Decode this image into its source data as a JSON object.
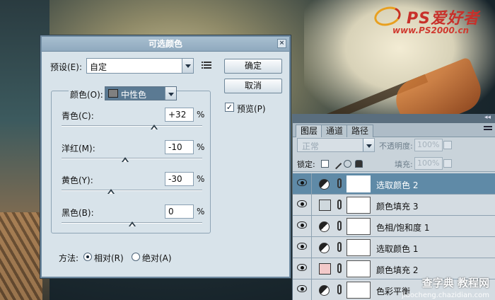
{
  "logo": {
    "brand": "PS爱好者",
    "url": "www.PS2000.cn"
  },
  "dialog": {
    "title": "可选颜色",
    "close": "×",
    "preset_label": "预设(E):",
    "preset_value": "自定",
    "ok": "确定",
    "cancel": "取消",
    "preview_label": "预览(P)",
    "preview_checked": true,
    "colors_label": "颜色(O):",
    "colors_value": "中性色",
    "sliders": [
      {
        "label": "青色(C):",
        "value": "+32",
        "unit": "%",
        "level": 32
      },
      {
        "label": "洋红(M):",
        "value": "-10",
        "unit": "%",
        "level": -10
      },
      {
        "label": "黄色(Y):",
        "value": "-30",
        "unit": "%",
        "level": -30
      },
      {
        "label": "黑色(B):",
        "value": "0",
        "unit": "%",
        "level": 0
      }
    ],
    "method_label": "方法:",
    "method_options": [
      "相对(R)",
      "绝对(A)"
    ],
    "method_selected": "相对(R)"
  },
  "layers_panel": {
    "tabs": [
      "图层",
      "通道",
      "路径"
    ],
    "active_tab": "图层",
    "blend_mode": "正常",
    "opacity_label": "不透明度:",
    "opacity_value": "100%",
    "lock_label": "锁定:",
    "fill_label": "填充:",
    "fill_value": "100%",
    "layers": [
      {
        "name": "选取颜色 2",
        "type": "adjustment",
        "selected": true
      },
      {
        "name": "颜色填充 3",
        "type": "fill",
        "swatch": "#cfd8dd",
        "selected": false
      },
      {
        "name": "色相/饱和度 1",
        "type": "adjustment",
        "selected": false
      },
      {
        "name": "选取颜色 1",
        "type": "adjustment",
        "selected": false
      },
      {
        "name": "颜色填充 2",
        "type": "fill",
        "swatch": "#f2c9c9",
        "selected": false
      },
      {
        "name": "色彩平衡",
        "type": "adjustment",
        "selected": false
      }
    ]
  },
  "watermark": {
    "line1": "查字典 教程网",
    "line2": "jiaocheng.chazidian.com"
  }
}
